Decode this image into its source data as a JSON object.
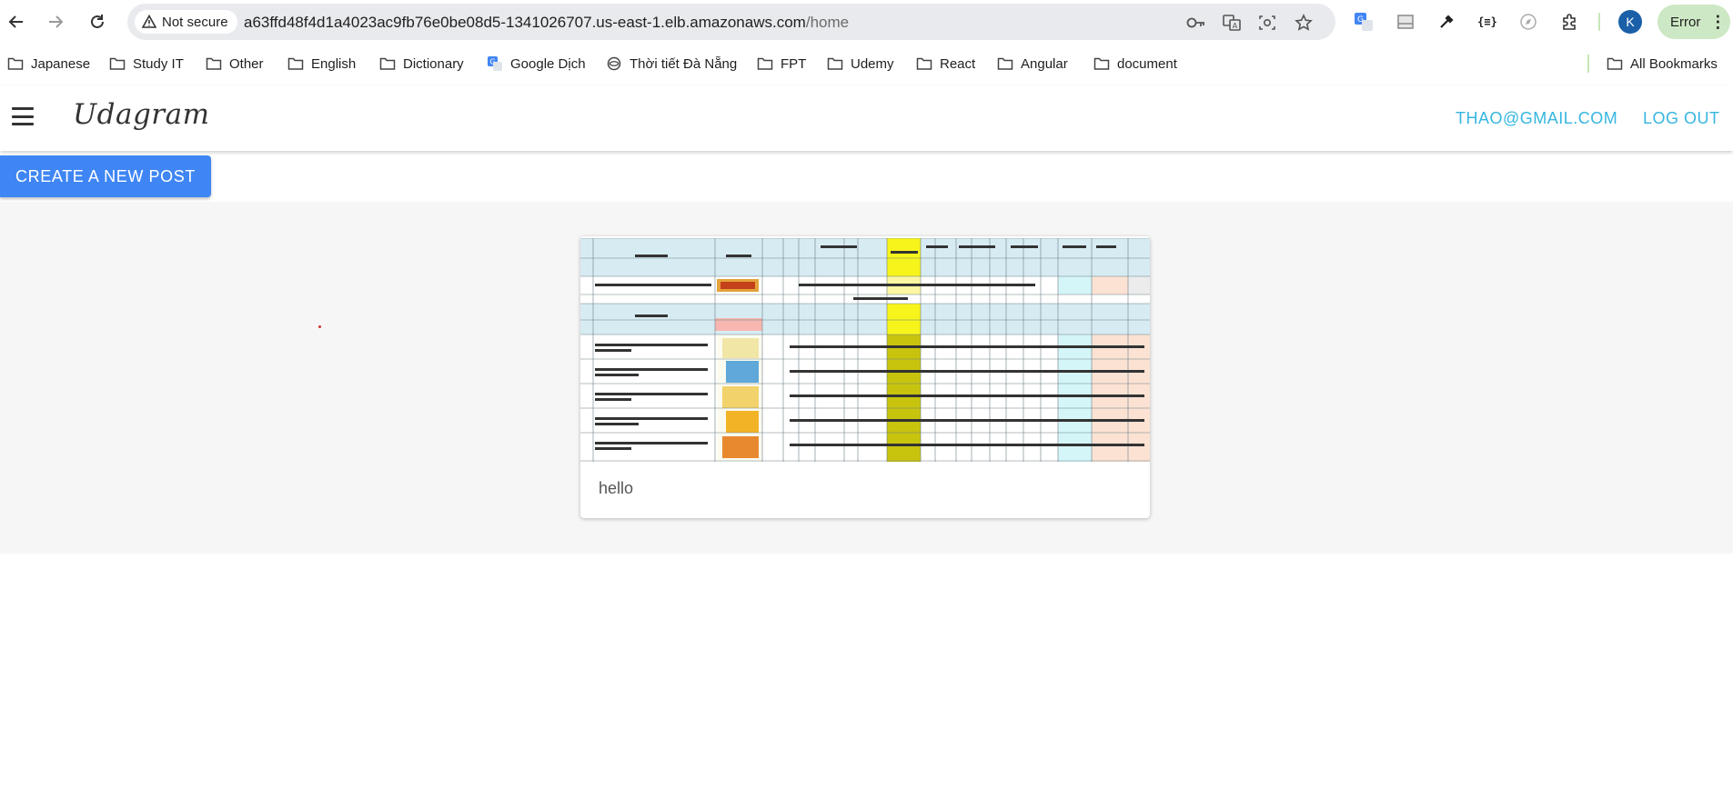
{
  "browser": {
    "security_label": "Not secure",
    "url_host": "a63ffd48f4d1a4023ac9fb76e0be08d5-1341026707.us-east-1.elb.amazonaws.com",
    "url_path": "/home",
    "profile_initial": "K",
    "error_label": "Error"
  },
  "bookmarks": [
    {
      "label": "Japanese",
      "icon": "folder-icon"
    },
    {
      "label": "Study IT",
      "icon": "folder-icon"
    },
    {
      "label": "Other",
      "icon": "folder-icon"
    },
    {
      "label": "English",
      "icon": "folder-icon"
    },
    {
      "label": "Dictionary",
      "icon": "folder-icon"
    },
    {
      "label": "Google Dịch",
      "icon": "google-translate-icon"
    },
    {
      "label": "Thời tiết Đà Nẵng",
      "icon": "weather-icon"
    },
    {
      "label": "FPT",
      "icon": "folder-icon"
    },
    {
      "label": "Udemy",
      "icon": "folder-icon"
    },
    {
      "label": "React",
      "icon": "folder-icon"
    },
    {
      "label": "Angular",
      "icon": "folder-icon"
    },
    {
      "label": "document",
      "icon": "folder-icon"
    }
  ],
  "all_bookmarks_label": "All Bookmarks",
  "app": {
    "brand": "Udagram",
    "user_email": "THAO@GMAIL.COM",
    "logout_label": "LOG OUT",
    "create_post_label": "CREATE A NEW POST"
  },
  "posts": [
    {
      "caption": "hello"
    }
  ],
  "colors": {
    "accent_link": "#36b6e0",
    "primary_button": "#3f86f4",
    "feed_background": "#f6f6f6"
  }
}
